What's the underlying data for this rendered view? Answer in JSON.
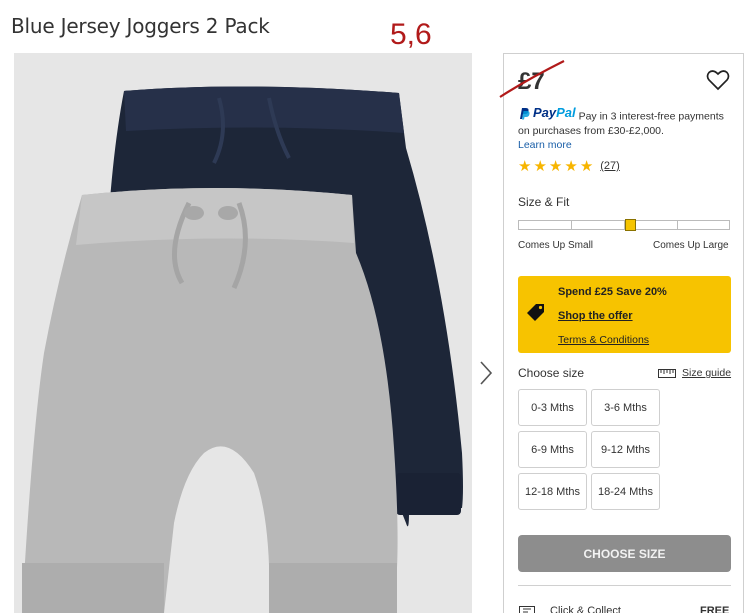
{
  "product": {
    "title": "Blue Jersey Joggers 2 Pack",
    "annotation": "5,6"
  },
  "gallery": {
    "image_icon": "product-photo",
    "next_icon": "chevron-right-icon"
  },
  "price": {
    "value": "£7",
    "wishlist_icon": "heart-icon"
  },
  "paypal": {
    "logo_pay": "Pay",
    "logo_pal": "Pal",
    "message": "Pay in 3 interest-free payments on purchases from £30-£2,000.",
    "learn_more": "Learn more"
  },
  "rating": {
    "stars": 5,
    "star_glyph": "★",
    "review_count": "(27)"
  },
  "size_fit": {
    "title": "Size & Fit",
    "low_label": "Comes Up Small",
    "high_label": "Comes Up Large",
    "level": 0.53
  },
  "offer": {
    "title": "Spend £25 Save 20%",
    "link": "Shop the offer",
    "terms": "Terms & Conditions",
    "icon": "price-tag-icon",
    "color": "#f7c300"
  },
  "choose_size": {
    "title": "Choose size",
    "guide_label": "Size guide",
    "guide_icon": "ruler-icon",
    "options": [
      "0-3 Mths",
      "3-6 Mths",
      "6-9 Mths",
      "9-12 Mths",
      "12-18 Mths",
      "18-24 Mths"
    ]
  },
  "cta": {
    "label": "CHOOSE SIZE",
    "color": "#8d8d8d"
  },
  "delivery": {
    "label": "Click & Collect",
    "price": "FREE",
    "icon": "store-icon"
  },
  "colors": {
    "annotation": "#b11a1a",
    "paypal_dark": "#003087",
    "paypal_light": "#009cde",
    "star": "#f7b500",
    "navy_garment": "#1d2638",
    "grey_garment": "#b8b8b8"
  }
}
